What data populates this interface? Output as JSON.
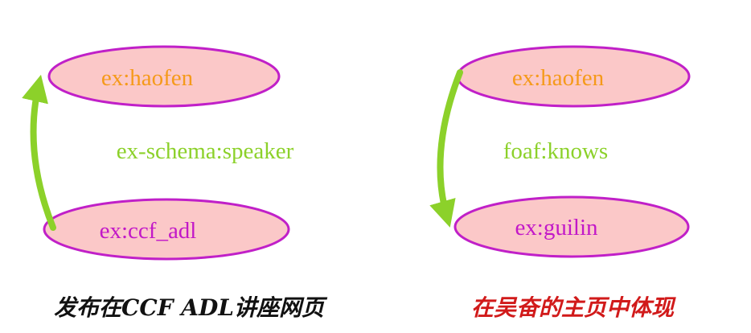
{
  "left_graph": {
    "top_node": "ex:haofen",
    "bottom_node": "ex:ccf_adl",
    "edge_label": "ex-schema:speaker",
    "caption": "发布在CCF ADL讲座网页"
  },
  "right_graph": {
    "top_node": "ex:haofen",
    "bottom_node": "ex:guilin",
    "edge_label": "foaf:knows",
    "caption": "在吴奋的主页中体现"
  },
  "colors": {
    "node_fill": "#fbc8c8",
    "node_stroke": "#c020c8",
    "haofen_text": "#f59a1a",
    "other_node_text": "#c218c8",
    "edge": "#8cd12a",
    "left_caption": "#111111",
    "right_caption": "#d11a1a"
  }
}
